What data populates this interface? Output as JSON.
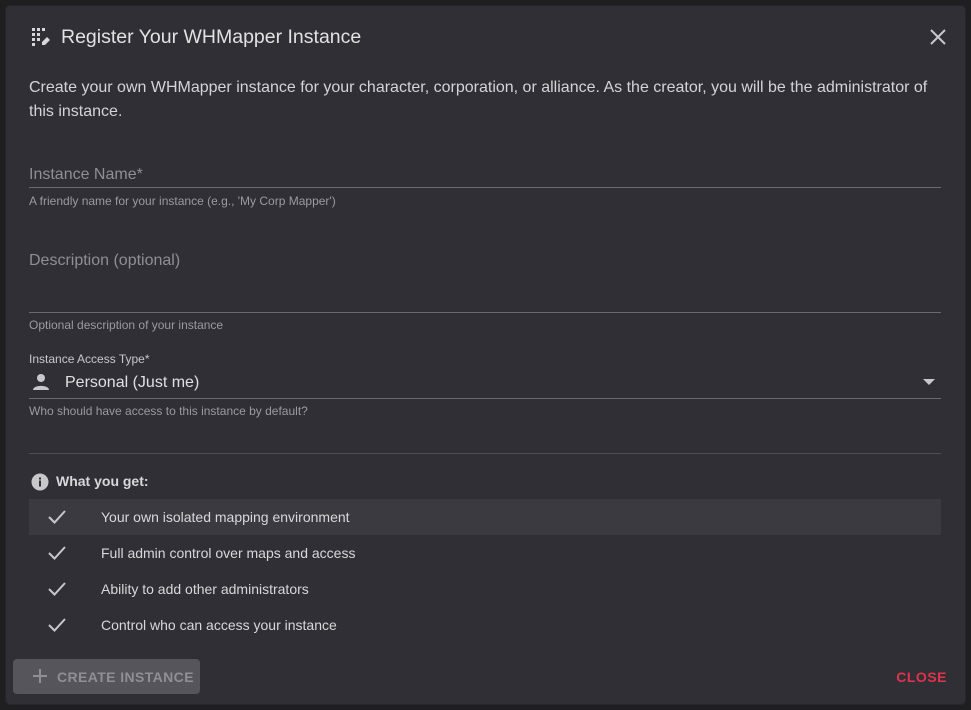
{
  "dialog": {
    "title": "Register Your WHMapper Instance",
    "title_icon": "app-grid-icon",
    "close_icon": "close-icon"
  },
  "intro_text": "Create your own WHMapper instance for your character, corporation, or alliance. As the creator, you will be the administrator of this instance.",
  "form": {
    "instance_name": {
      "label": "Instance Name*",
      "value": "",
      "helper": "A friendly name for your instance (e.g., 'My Corp Mapper')"
    },
    "description": {
      "label": "Description (optional)",
      "value": "",
      "helper": "Optional description of your instance"
    },
    "access_type": {
      "label": "Instance Access Type*",
      "selected": "Personal (Just me)",
      "icon": "person-icon",
      "helper": "Who should have access to this instance by default?"
    }
  },
  "benefits": {
    "heading": "What you get:",
    "heading_icon": "info-icon",
    "items": [
      "Your own isolated mapping environment",
      "Full admin control over maps and access",
      "Ability to add other administrators",
      "Control who can access your instance"
    ]
  },
  "actions": {
    "create_label": "CREATE INSTANCE",
    "create_icon": "plus-icon",
    "close_label": "CLOSE"
  },
  "colors": {
    "dialog_bg": "#2f2f35",
    "accent_danger": "#e0334c",
    "disabled_button": "#55555b"
  }
}
